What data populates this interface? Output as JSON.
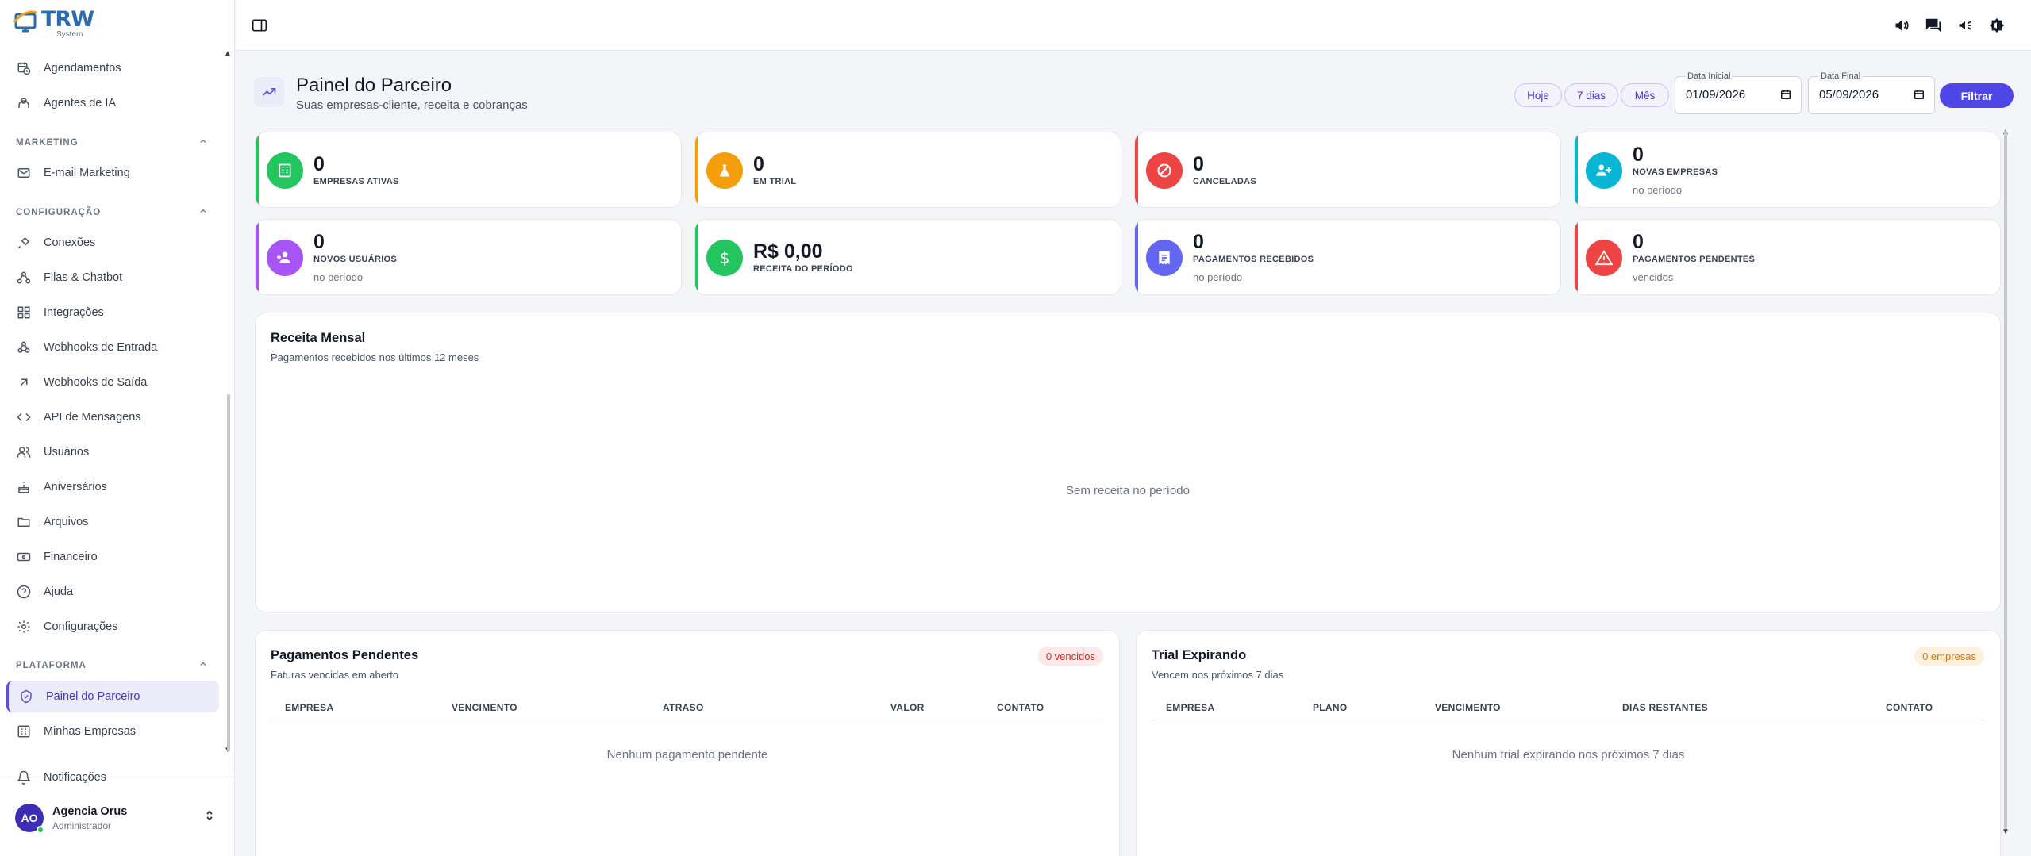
{
  "app": {
    "logo_text": "TRW",
    "logo_sub": "System"
  },
  "sidebar": {
    "items_top": [
      {
        "label": "Agendamentos",
        "icon": "calendar-clock-icon"
      },
      {
        "label": "Agentes de IA",
        "icon": "ai-agent-icon"
      }
    ],
    "sections": [
      {
        "label": "MARKETING"
      },
      {
        "label": "CONFIGURAÇÃO"
      },
      {
        "label": "PLATAFORMA"
      }
    ],
    "marketing_items": [
      {
        "label": "E-mail Marketing",
        "icon": "mail-icon"
      }
    ],
    "config_items": [
      {
        "label": "Conexões",
        "icon": "plug-icon"
      },
      {
        "label": "Filas & Chatbot",
        "icon": "queue-icon"
      },
      {
        "label": "Integrações",
        "icon": "blocks-icon"
      },
      {
        "label": "Webhooks de Entrada",
        "icon": "webhook-icon"
      },
      {
        "label": "Webhooks de Saída",
        "icon": "arrow-up-right-icon"
      },
      {
        "label": "API de Mensagens",
        "icon": "code-icon"
      },
      {
        "label": "Usuários",
        "icon": "users-icon"
      },
      {
        "label": "Aniversários",
        "icon": "cake-icon"
      },
      {
        "label": "Arquivos",
        "icon": "folder-icon"
      },
      {
        "label": "Financeiro",
        "icon": "banknote-icon"
      },
      {
        "label": "Ajuda",
        "icon": "help-circle-icon"
      },
      {
        "label": "Configurações",
        "icon": "gear-icon"
      }
    ],
    "platform_items": [
      {
        "label": "Painel do Parceiro",
        "icon": "shield-check-icon",
        "active": true
      },
      {
        "label": "Minhas Empresas",
        "icon": "building-icon"
      }
    ],
    "notifications_label": "Notificações",
    "user": {
      "initials": "AO",
      "name": "Agencia Orus",
      "role": "Administrador"
    }
  },
  "header": {
    "title": "Painel do Parceiro",
    "subtitle": "Suas empresas-cliente, receita e cobranças",
    "presets": [
      "Hoje",
      "7 dias",
      "Mês"
    ],
    "date_start_label": "Data Inicial",
    "date_start": "01/09/2026",
    "date_end_label": "Data Final",
    "date_end": "05/09/2026",
    "filter_label": "Filtrar"
  },
  "stats": [
    {
      "value": "0",
      "label": "EMPRESAS ATIVAS",
      "sub": "",
      "color": "#22c55e",
      "icon": "building-icon"
    },
    {
      "value": "0",
      "label": "EM TRIAL",
      "sub": "",
      "color": "#f59e0b",
      "icon": "flask-icon"
    },
    {
      "value": "0",
      "label": "CANCELADAS",
      "sub": "",
      "color": "#ef4444",
      "icon": "ban-icon"
    },
    {
      "value": "0",
      "label": "NOVAS EMPRESAS",
      "sub": "no período",
      "color": "#06b6d4",
      "icon": "users-plus-icon"
    },
    {
      "value": "0",
      "label": "NOVOS USUÁRIOS",
      "sub": "no período",
      "color": "#a855f7",
      "icon": "user-plus-icon"
    },
    {
      "value": "R$ 0,00",
      "label": "RECEITA DO PERÍODO",
      "sub": "",
      "color": "#22c55e",
      "icon": "dollar-icon"
    },
    {
      "value": "0",
      "label": "PAGAMENTOS RECEBIDOS",
      "sub": "no período",
      "color": "#6366f1",
      "icon": "receipt-icon"
    },
    {
      "value": "0",
      "label": "PAGAMENTOS PENDENTES",
      "sub": "vencidos",
      "color": "#ef4444",
      "icon": "alert-triangle-icon"
    }
  ],
  "revenue": {
    "title": "Receita Mensal",
    "subtitle": "Pagamentos recebidos nos últimos 12 meses",
    "empty": "Sem receita no período"
  },
  "pending": {
    "title": "Pagamentos Pendentes",
    "subtitle": "Faturas vencidas em aberto",
    "badge": "0 vencidos",
    "columns": [
      "EMPRESA",
      "VENCIMENTO",
      "ATRASO",
      "VALOR",
      "CONTATO"
    ],
    "empty": "Nenhum pagamento pendente"
  },
  "trial": {
    "title": "Trial Expirando",
    "subtitle": "Vencem nos próximos 7 dias",
    "badge": "0 empresas",
    "columns": [
      "EMPRESA",
      "PLANO",
      "VENCIMENTO",
      "DIAS RESTANTES",
      "CONTATO"
    ],
    "empty": "Nenhum trial expirando nos próximos 7 dias"
  }
}
